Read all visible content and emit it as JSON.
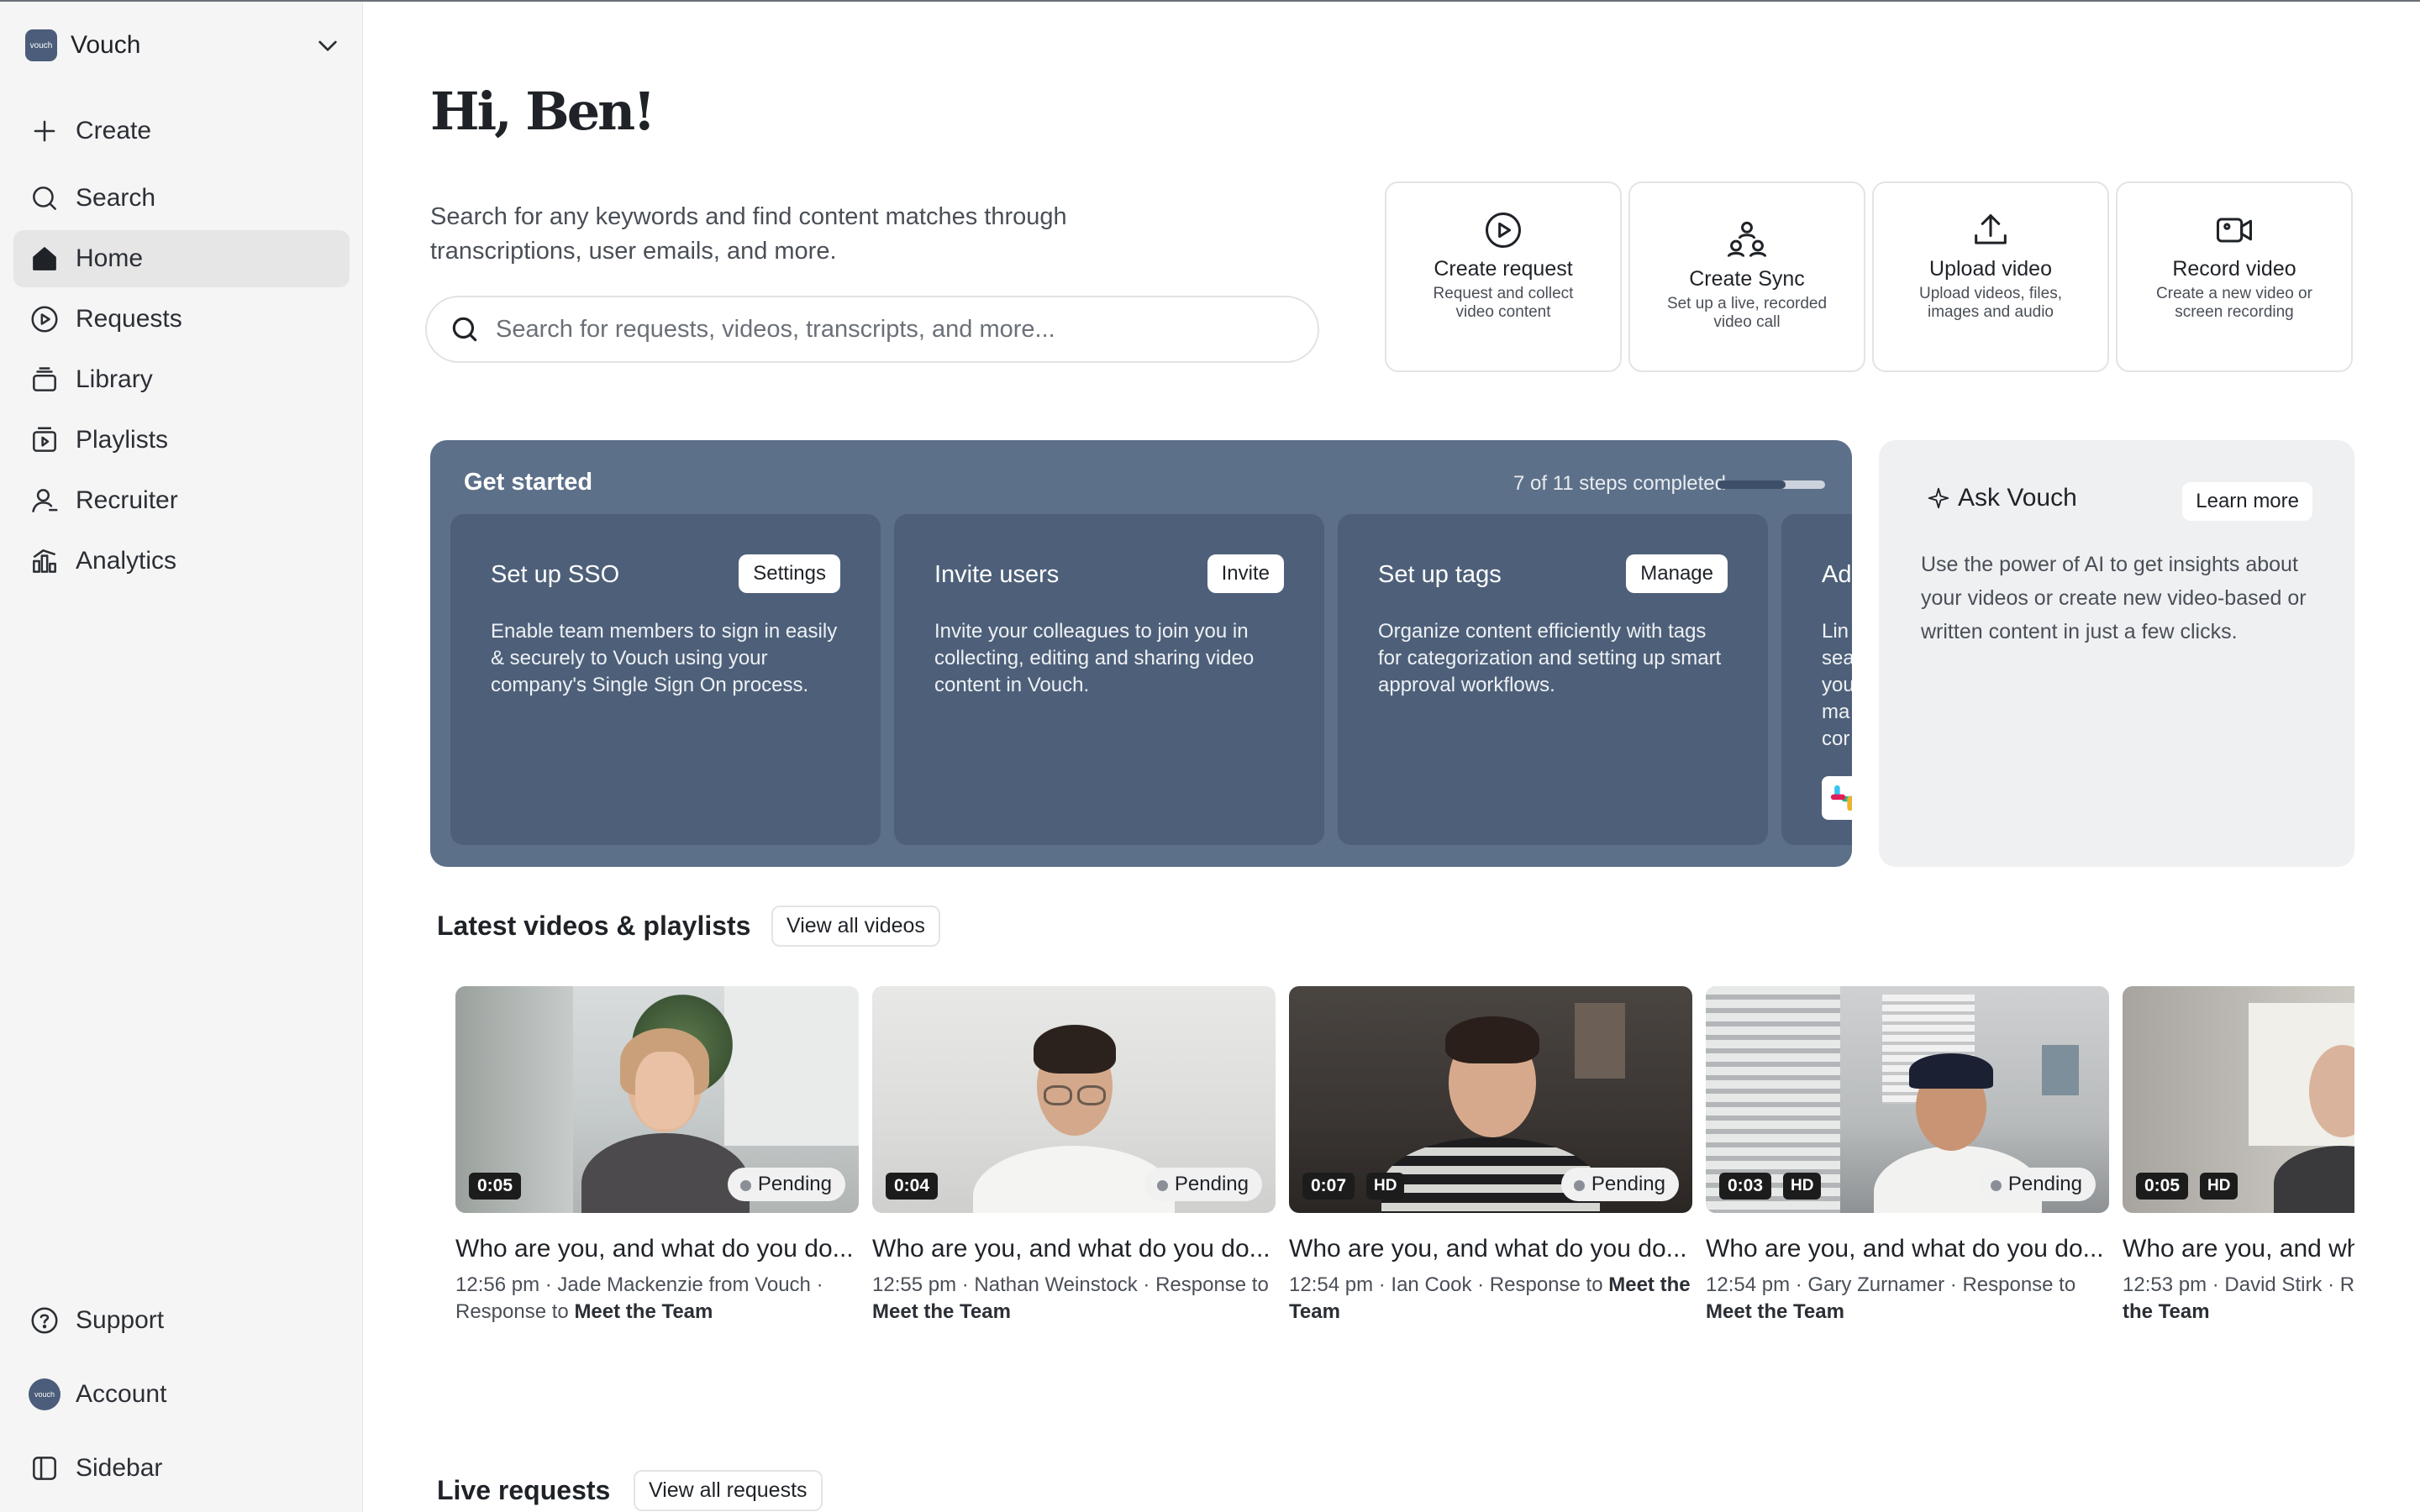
{
  "workspace": {
    "logo_text": "vouch",
    "name": "Vouch"
  },
  "nav": {
    "create": "Create",
    "search": "Search",
    "home": "Home",
    "requests": "Requests",
    "library": "Library",
    "playlists": "Playlists",
    "recruiter": "Recruiter",
    "analytics": "Analytics",
    "support": "Support",
    "account": "Account",
    "sidebar": "Sidebar"
  },
  "header": {
    "greeting": "Hi, Ben!",
    "intro": "Search for any keywords and find content matches through transcriptions, user emails, and more.",
    "search_placeholder": "Search for requests, videos, transcripts, and more..."
  },
  "quick_actions": [
    {
      "title": "Create request",
      "desc": "Request and collect video content",
      "icon": "play-circle-icon"
    },
    {
      "title": "Create Sync",
      "desc": "Set up a live, recorded video call",
      "icon": "people-sync-icon"
    },
    {
      "title": "Upload video",
      "desc": "Upload videos, files, images and audio",
      "icon": "upload-icon"
    },
    {
      "title": "Record video",
      "desc": "Create a new video or screen recording",
      "icon": "video-camera-icon"
    }
  ],
  "get_started": {
    "title": "Get started",
    "progress_text": "7 of 11 steps completed",
    "progress_fraction": 0.636,
    "cards": [
      {
        "title": "Set up SSO",
        "button": "Settings",
        "desc": "Enable team members to sign in easily & securely to Vouch using your company's Single Sign On process."
      },
      {
        "title": "Invite users",
        "button": "Invite",
        "desc": "Invite your colleagues to join you in collecting, editing and sharing video content in Vouch."
      },
      {
        "title": "Set up tags",
        "button": "Manage",
        "desc": "Organize content efficiently with tags for categorization and setting up smart approval workflows."
      },
      {
        "title": "Ad",
        "desc": "Lin sea you ma cor"
      }
    ]
  },
  "ask_vouch": {
    "title": "Ask Vouch",
    "button": "Learn more",
    "desc": "Use the power of AI to get insights about your videos or create new video-based or written content in just a few clicks."
  },
  "latest": {
    "heading": "Latest videos & playlists",
    "view_all": "View all videos",
    "videos": [
      {
        "duration": "0:05",
        "hd": "",
        "status": "Pending",
        "title": "Who are you, and what do you do...",
        "time": "12:56 pm",
        "author": "Jade Mackenzie from Vouch",
        "response_to": "Response to",
        "playlist": "Meet the Team"
      },
      {
        "duration": "0:04",
        "hd": "",
        "status": "Pending",
        "title": "Who are you, and what do you do...",
        "time": "12:55 pm",
        "author": "Nathan Weinstock",
        "response_to": "Response to",
        "playlist": "Meet the Team"
      },
      {
        "duration": "0:07",
        "hd": "HD",
        "status": "Pending",
        "title": "Who are you, and what do you do...",
        "time": "12:54 pm",
        "author": "Ian Cook",
        "response_to": "Response to",
        "playlist": "Meet the Team"
      },
      {
        "duration": "0:03",
        "hd": "HD",
        "status": "Pending",
        "title": "Who are you, and what do you do...",
        "time": "12:54 pm",
        "author": "Gary Zurnamer",
        "response_to": "Response to",
        "playlist": "Meet the Team"
      },
      {
        "duration": "0:05",
        "hd": "HD",
        "status": "",
        "title": "Who are you, and what do you do...",
        "time": "12:53 pm",
        "author": "David Stirk",
        "response_to": "Response to",
        "playlist": "Meet the Team"
      }
    ]
  },
  "live": {
    "heading": "Live requests",
    "view_all": "View all requests"
  },
  "colors": {
    "get_started_bg": "#5d7089",
    "card_bg": "#4e6079",
    "ask_bg": "#eef0f2",
    "sidebar_bg": "#f5f5f5",
    "active_nav": "#e6e6e7"
  }
}
